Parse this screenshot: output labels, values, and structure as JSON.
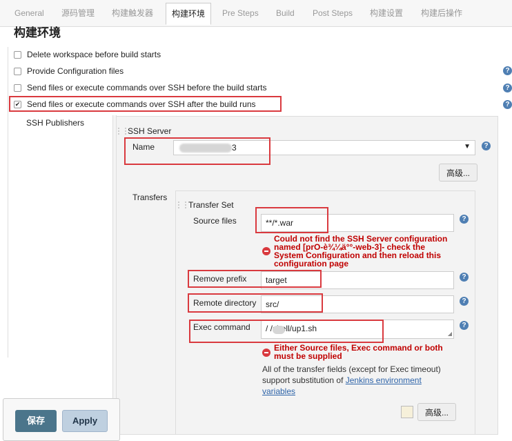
{
  "tabs": [
    "General",
    "源码管理",
    "构建触发器",
    "构建环境",
    "Pre Steps",
    "Build",
    "Post Steps",
    "构建设置",
    "构建后操作"
  ],
  "section_title": "构建环境",
  "options": [
    {
      "label": "Delete workspace before build starts",
      "checked": false
    },
    {
      "label": "Provide Configuration files",
      "checked": false
    },
    {
      "label": "Send files or execute commands over SSH before the build starts",
      "checked": false
    },
    {
      "label": "Send files or execute commands over SSH after the build runs",
      "checked": true
    }
  ],
  "ssh_publishers_label": "SSH Publishers",
  "ssh_server_label": "SSH Server",
  "name_label": "Name",
  "name_value": "3",
  "advanced_label": "高级...",
  "transfers_label": "Transfers",
  "transfer_set_label": "Transfer Set",
  "source_files_label": "Source files",
  "source_files_value": "**/*.war",
  "source_error": [
    "Could not find the SSH Server configuration",
    "named [prO-è¾¼ä°°-web-3]- check the",
    "System Configuration and then reload this",
    "configuration page"
  ],
  "remove_prefix_label": "Remove prefix",
  "remove_prefix_value": "target",
  "remote_directory_label": "Remote directory",
  "remote_directory_value": "src/",
  "exec_command_label": "Exec command",
  "exec_command_value": "/    /shell/up1.sh",
  "exec_error": [
    "Either Source files, Exec command or both",
    "must be supplied"
  ],
  "desc_text_1": "All of the transfer fields (except for Exec timeout)",
  "desc_text_2": "support substitution of",
  "desc_link_1": "Jenkins environment",
  "desc_link_2": "variables",
  "save_label": "保存",
  "apply_label": "Apply",
  "colors": {
    "accent": "#4b758b",
    "error": "#c00000",
    "highlight": "#d9393e",
    "help": "#4f7fb3"
  }
}
